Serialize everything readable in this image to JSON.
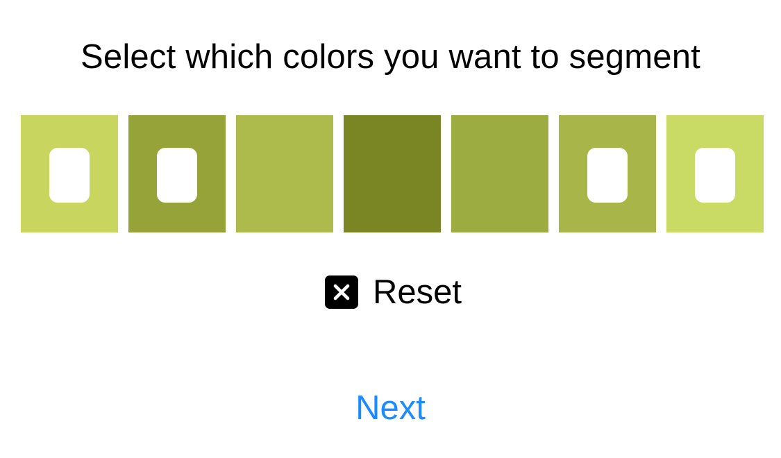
{
  "header": {
    "title": "Select which colors you want to segment"
  },
  "swatches": [
    {
      "color": "#c8d55f",
      "selected": true
    },
    {
      "color": "#96a339",
      "selected": true
    },
    {
      "color": "#adbb4d",
      "selected": false
    },
    {
      "color": "#7a8524",
      "selected": false
    },
    {
      "color": "#9dac40",
      "selected": false
    },
    {
      "color": "#a8b548",
      "selected": true
    },
    {
      "color": "#cadb65",
      "selected": true
    }
  ],
  "reset": {
    "label": "Reset",
    "icon": "close-icon"
  },
  "footer": {
    "next_label": "Next",
    "next_color": "#1a8cff"
  }
}
